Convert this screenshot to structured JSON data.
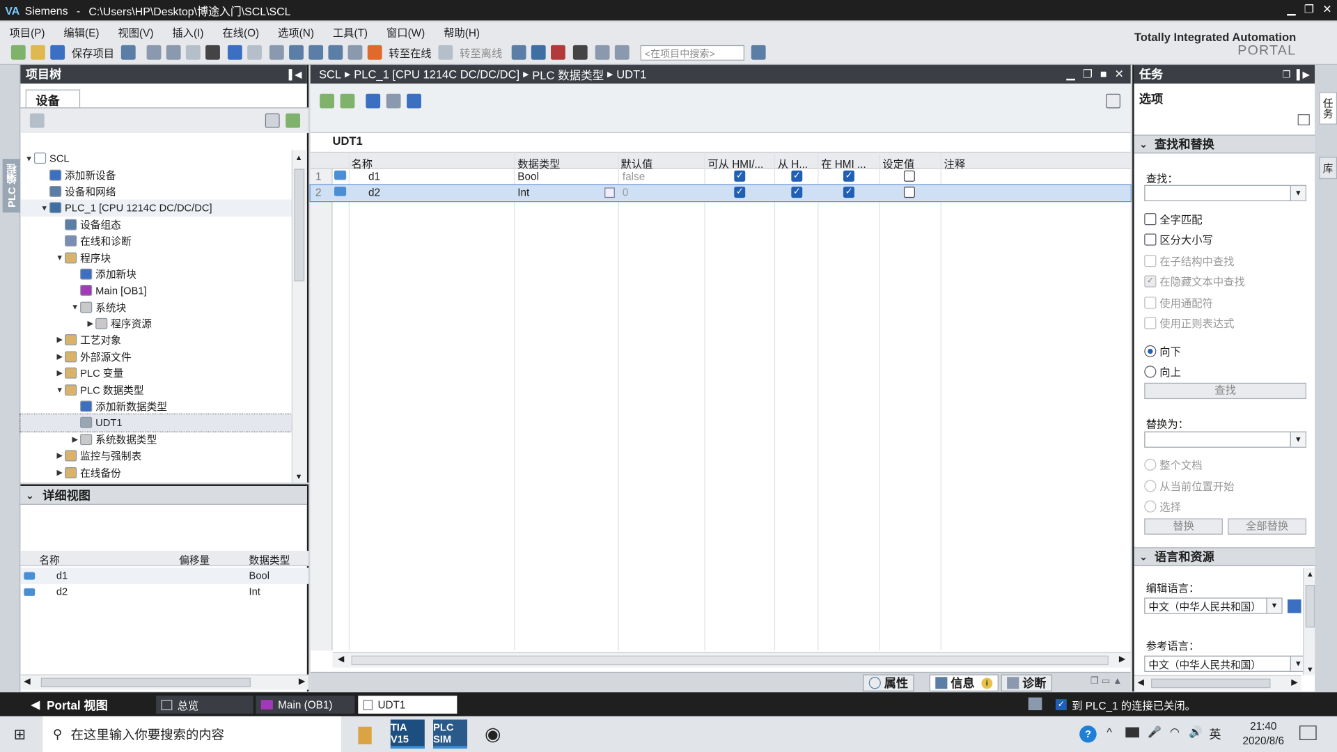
{
  "window": {
    "title_app": "Siemens",
    "title_path": "C:\\Users\\HP\\Desktop\\博途入门\\SCL\\SCL"
  },
  "menu": [
    "项目(P)",
    "编辑(E)",
    "视图(V)",
    "插入(I)",
    "在线(O)",
    "选项(N)",
    "工具(T)",
    "窗口(W)",
    "帮助(H)"
  ],
  "toolbar": {
    "save_label": "保存项目",
    "go_online": "转至在线",
    "go_offline": "转至离线",
    "search_placeholder": "<在项目中搜索>"
  },
  "brand": {
    "line1": "Totally Integrated Automation",
    "line2": "PORTAL"
  },
  "left_strip": "PLC 编程",
  "project_tree": {
    "title": "项目树",
    "tab": "设备",
    "items": [
      {
        "label": "SCL",
        "level": 0,
        "arrow": "▼",
        "icon": "project-icon",
        "color": "#ffffff"
      },
      {
        "label": "添加新设备",
        "level": 1,
        "arrow": "",
        "icon": "add-device-icon",
        "color": "#3a6fc1"
      },
      {
        "label": "设备和网络",
        "level": 1,
        "arrow": "",
        "icon": "network-icon",
        "color": "#5a7ea6"
      },
      {
        "label": "PLC_1 [CPU 1214C DC/DC/DC]",
        "level": 1,
        "arrow": "▼",
        "icon": "plc-icon",
        "color": "#3d6fa3"
      },
      {
        "label": "设备组态",
        "level": 2,
        "arrow": "",
        "icon": "device-config-icon",
        "color": "#5a7ea6"
      },
      {
        "label": "在线和诊断",
        "level": 2,
        "arrow": "",
        "icon": "diagnostics-icon",
        "color": "#7a8db3"
      },
      {
        "label": "程序块",
        "level": 2,
        "arrow": "▼",
        "icon": "folder-icon",
        "color": "#d9b36a"
      },
      {
        "label": "添加新块",
        "level": 3,
        "arrow": "",
        "icon": "add-block-icon",
        "color": "#3a6fc1"
      },
      {
        "label": "Main [OB1]",
        "level": 3,
        "arrow": "",
        "icon": "ob-icon",
        "color": "#a339b8"
      },
      {
        "label": "系统块",
        "level": 3,
        "arrow": "▼",
        "icon": "folder-icon",
        "color": "#c9c9c9"
      },
      {
        "label": "程序资源",
        "level": 4,
        "arrow": "▶",
        "icon": "folder-icon",
        "color": "#c9c9c9"
      },
      {
        "label": "工艺对象",
        "level": 2,
        "arrow": "▶",
        "icon": "tech-object-icon",
        "color": "#d9b36a"
      },
      {
        "label": "外部源文件",
        "level": 2,
        "arrow": "▶",
        "icon": "source-file-icon",
        "color": "#d9b36a"
      },
      {
        "label": "PLC 变量",
        "level": 2,
        "arrow": "▶",
        "icon": "tags-icon",
        "color": "#d9b36a"
      },
      {
        "label": "PLC 数据类型",
        "level": 2,
        "arrow": "▼",
        "icon": "datatype-folder-icon",
        "color": "#d9b36a"
      },
      {
        "label": "添加新数据类型",
        "level": 3,
        "arrow": "",
        "icon": "add-datatype-icon",
        "color": "#3a6fc1"
      },
      {
        "label": "UDT1",
        "level": 3,
        "arrow": "",
        "icon": "udt-icon",
        "color": "#9aa6b3"
      },
      {
        "label": "系统数据类型",
        "level": 3,
        "arrow": "▶",
        "icon": "folder-icon",
        "color": "#c9c9c9"
      },
      {
        "label": "监控与强制表",
        "level": 2,
        "arrow": "▶",
        "icon": "watch-table-icon",
        "color": "#d9b36a"
      },
      {
        "label": "在线备份",
        "level": 2,
        "arrow": "▶",
        "icon": "backup-icon",
        "color": "#d9b36a"
      }
    ]
  },
  "detail_view": {
    "title": "详细视图",
    "columns": [
      "名称",
      "偏移量",
      "数据类型"
    ],
    "rows": [
      {
        "name": "d1",
        "offset": "",
        "type": "Bool"
      },
      {
        "name": "d2",
        "offset": "",
        "type": "Int"
      }
    ]
  },
  "editor": {
    "breadcrumb": [
      "SCL",
      "PLC_1 [CPU 1214C DC/DC/DC]",
      "PLC 数据类型",
      "UDT1"
    ],
    "udt_name": "UDT1",
    "columns": [
      "名称",
      "数据类型",
      "默认值",
      "可从 HMI/...",
      "从 H...",
      "在 HMI ...",
      "设定值",
      "注释"
    ],
    "rows": [
      {
        "no": "1",
        "name": "d1",
        "type": "Bool",
        "default": "false",
        "hmi_access": true,
        "hmi_write": true,
        "hmi_visible": true,
        "setpoint": false,
        "comment": ""
      },
      {
        "no": "2",
        "name": "d2",
        "type": "Int",
        "default": "0",
        "hmi_access": true,
        "hmi_write": true,
        "hmi_visible": true,
        "setpoint": false,
        "comment": ""
      }
    ],
    "bottom_tabs": [
      "属性",
      "信息",
      "诊断"
    ]
  },
  "tasks": {
    "title": "任务",
    "options_label": "选项",
    "find_replace": {
      "title": "查找和替换",
      "find_label": "查找：",
      "options": [
        {
          "label": "全字匹配",
          "checked": false,
          "disabled": false
        },
        {
          "label": "区分大小写",
          "checked": false,
          "disabled": false
        },
        {
          "label": "在子结构中查找",
          "checked": false,
          "disabled": true
        },
        {
          "label": "在隐藏文本中查找",
          "checked": true,
          "disabled": true
        },
        {
          "label": "使用通配符",
          "checked": false,
          "disabled": true
        },
        {
          "label": "使用正则表达式",
          "checked": false,
          "disabled": true
        }
      ],
      "direction": [
        {
          "label": "向下",
          "selected": true
        },
        {
          "label": "向上",
          "selected": false
        }
      ],
      "find_button": "查找",
      "replace_label": "替换为：",
      "scope": [
        {
          "label": "整个文档"
        },
        {
          "label": "从当前位置开始"
        },
        {
          "label": "选择"
        }
      ],
      "replace_button": "替换",
      "replace_all_button": "全部替换"
    },
    "language": {
      "title": "语言和资源",
      "edit_lang_label": "编辑语言：",
      "edit_lang_value": "中文（中华人民共和国）",
      "ref_lang_label": "参考语言：",
      "ref_lang_value": "中文（中华人民共和国）"
    }
  },
  "right_strip": [
    "任务",
    "库"
  ],
  "portal_bar": {
    "portal_view": "Portal 视图",
    "tabs": [
      "总览",
      "Main (OB1)",
      "UDT1"
    ],
    "status": "到 PLC_1 的连接已关闭。"
  },
  "taskbar": {
    "search_placeholder": "在这里输入你要搜索的内容",
    "apps": [
      "TIA V15",
      "PLC SIM"
    ],
    "ime": "英",
    "time": "21:40",
    "date": "2020/8/6"
  }
}
